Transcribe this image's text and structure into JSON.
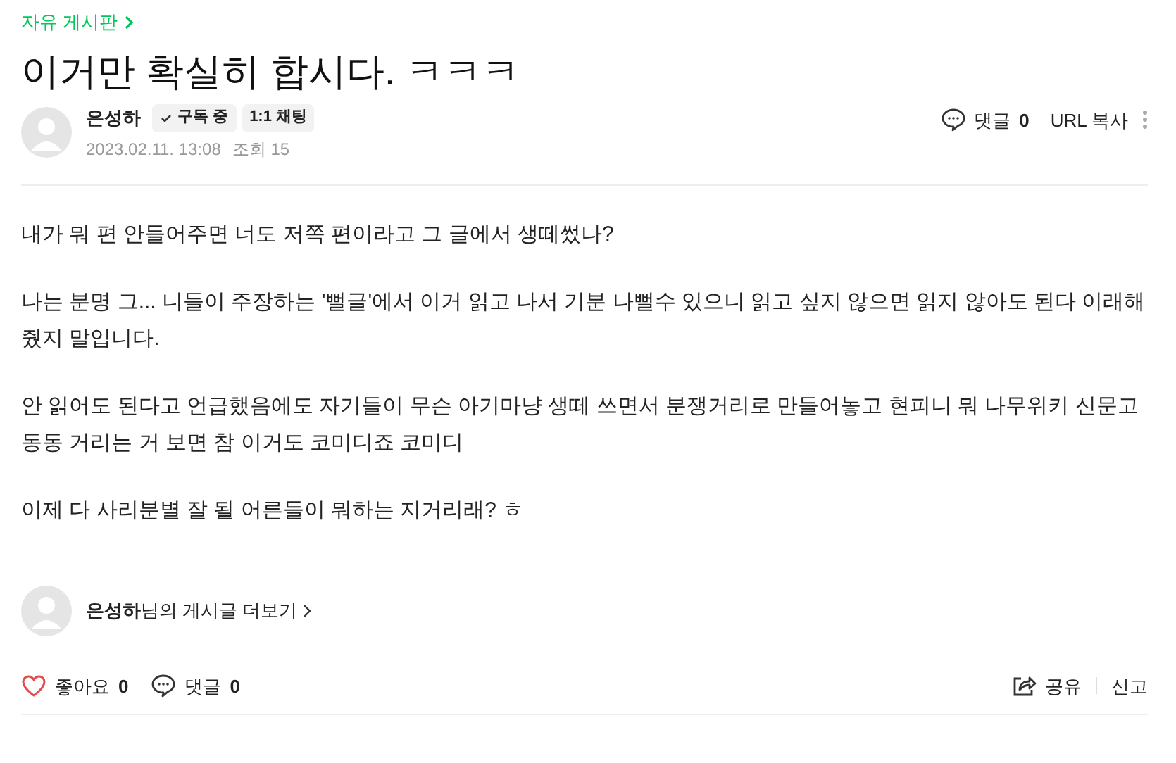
{
  "board": {
    "label": "자유 게시판"
  },
  "title": "이거만 확실히 합시다. ㅋㅋㅋ",
  "author": {
    "name": "은성하",
    "subscribe": {
      "label": "구독 중",
      "checked": true
    },
    "chat": "1:1 채팅",
    "date": "2023.02.11. 13:08",
    "views": "조회 15"
  },
  "header_actions": {
    "comments_label": "댓글",
    "comments_count": "0",
    "copy_url": "URL 복사"
  },
  "paragraphs": [
    "내가 뭐 편 안들어주면 너도 저쪽 편이라고 그 글에서 생떼썼나?",
    "나는 분명 그... 니들이 주장하는 '뻘글'에서 이거 읽고 나서 기분 나뻘수 있으니 읽고 싶지 않으면 읽지 않아도 된다 이래해줬지 말입니다.",
    "안 읽어도 된다고 언급했음에도 자기들이 무슨 아기마냥 생떼 쓰면서 분쟁거리로 만들어놓고 현피니 뭐 나무위키 신문고 동동 거리는 거 보면 참 이거도 코미디죠 코미디",
    "이제 다 사리분별 잘 될 어른들이 뭐하는 지거리래? ㅎ"
  ],
  "more_posts": "**은성하**님의 게시글 더보기",
  "footer": {
    "like_label": "좋아요",
    "like_count": "0",
    "liked": false,
    "comments_label": "댓글",
    "comments_count": "0",
    "share": "공유",
    "report": "신고"
  }
}
